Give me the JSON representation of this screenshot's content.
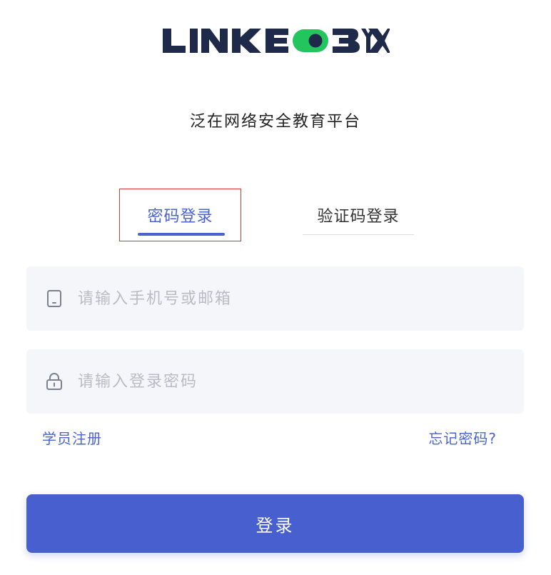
{
  "brand": {
    "logo_text": "LINKEDBYX",
    "colors": {
      "logo_dark": "#1f2a4a",
      "logo_accent": "#22c55e"
    }
  },
  "subtitle": "泛在网络安全教育平台",
  "tabs": [
    {
      "label": "密码登录",
      "active": true
    },
    {
      "label": "验证码登录",
      "active": false
    }
  ],
  "form": {
    "account": {
      "icon": "phone-icon",
      "placeholder": "请输入手机号或邮箱",
      "value": ""
    },
    "password": {
      "icon": "lock-icon",
      "placeholder": "请输入登录密码",
      "value": ""
    }
  },
  "links": {
    "register": "学员注册",
    "forgot": "忘记密码?"
  },
  "login_button": "登录",
  "colors": {
    "primary": "#475fcf",
    "tab_active": "#4a63d2",
    "highlight_border": "#e0342f",
    "field_background": "#f5f6f9",
    "placeholder": "#b9bcc4"
  }
}
